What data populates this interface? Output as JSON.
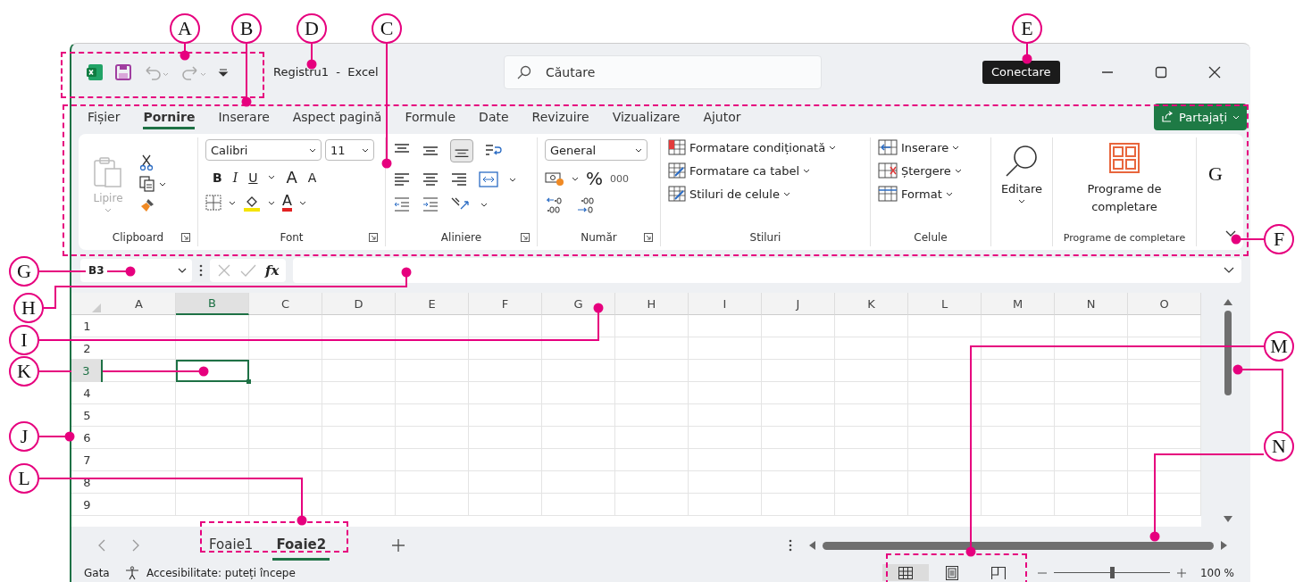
{
  "window": {
    "title": "Registru1  -  Excel"
  },
  "title_bar": {
    "search_placeholder": "Căutare",
    "sign_in": "Conectare"
  },
  "ribbon_tabs": [
    {
      "label": "Fișier",
      "selected": false
    },
    {
      "label": "Pornire",
      "selected": true
    },
    {
      "label": "Inserare",
      "selected": false
    },
    {
      "label": "Aspect pagină",
      "selected": false
    },
    {
      "label": "Formule",
      "selected": false
    },
    {
      "label": "Date",
      "selected": false
    },
    {
      "label": "Revizuire",
      "selected": false
    },
    {
      "label": "Vizualizare",
      "selected": false
    },
    {
      "label": "Ajutor",
      "selected": false
    }
  ],
  "share_button": "Partajați",
  "ribbon": {
    "clipboard": {
      "paste": "Lipire",
      "paste_disabled": true,
      "label": "Clipboard"
    },
    "font": {
      "font_name": "Calibri",
      "font_size": "11",
      "bold": "B",
      "italic": "I",
      "underline": "U",
      "grow_font": "A",
      "shrink_font": "A",
      "font_color": "A",
      "label": "Font"
    },
    "alignment": {
      "label": "Aliniere"
    },
    "number": {
      "format": "General",
      "percent": "%",
      "thousands": "000",
      "label": "Număr"
    },
    "styles": {
      "items": [
        "Formatare condiționată",
        "Formatare ca tabel",
        "Stiluri de celule"
      ],
      "label": "Stiluri"
    },
    "cells": {
      "items": [
        "Inserare",
        "Ștergere",
        "Format"
      ],
      "label": "Celule"
    },
    "editing": {
      "label": "Editare"
    },
    "addins": {
      "button": "Programe de completare",
      "label": "Programe de completare"
    }
  },
  "formula_bar": {
    "name_box": "B3",
    "fx": "fx"
  },
  "grid": {
    "columns": [
      {
        "label": "A",
        "selected": false
      },
      {
        "label": "B",
        "selected": true
      },
      {
        "label": "C",
        "selected": false
      },
      {
        "label": "D",
        "selected": false
      },
      {
        "label": "E",
        "selected": false
      },
      {
        "label": "F",
        "selected": false
      },
      {
        "label": "G",
        "selected": false
      },
      {
        "label": "H",
        "selected": false
      },
      {
        "label": "I",
        "selected": false
      },
      {
        "label": "J",
        "selected": false
      },
      {
        "label": "K",
        "selected": false
      },
      {
        "label": "L",
        "selected": false
      },
      {
        "label": "M",
        "selected": false
      },
      {
        "label": "N",
        "selected": false
      },
      {
        "label": "O",
        "selected": false
      }
    ],
    "rows": [
      {
        "label": "1",
        "selected": false
      },
      {
        "label": "2",
        "selected": false
      },
      {
        "label": "3",
        "selected": true
      },
      {
        "label": "4",
        "selected": false
      },
      {
        "label": "5",
        "selected": false
      },
      {
        "label": "6",
        "selected": false
      },
      {
        "label": "7",
        "selected": false
      },
      {
        "label": "8",
        "selected": false
      },
      {
        "label": "9",
        "selected": false
      }
    ]
  },
  "sheets": [
    {
      "label": "Foaie1",
      "selected": false
    },
    {
      "label": "Foaie2",
      "selected": true
    }
  ],
  "status_bar": {
    "status": "Gata",
    "accessibility": "Accesibilitate: puteți începe",
    "views": [
      {
        "kind": "normal",
        "selected": true
      },
      {
        "kind": "page_layout",
        "selected": false
      },
      {
        "kind": "page_break",
        "selected": false
      }
    ],
    "zoom": {
      "level": 0.5,
      "reading": "100 %"
    }
  },
  "annotations": [
    {
      "letter": "A",
      "kind": "circle"
    },
    {
      "letter": "B",
      "kind": "circle"
    },
    {
      "letter": "D",
      "kind": "circle"
    },
    {
      "letter": "C",
      "kind": "circle"
    },
    {
      "letter": "E",
      "kind": "circle"
    },
    {
      "letter": "G",
      "kind": "plain"
    },
    {
      "letter": "F",
      "kind": "circle"
    },
    {
      "letter": "G",
      "kind": "circle"
    },
    {
      "letter": "H",
      "kind": "circle"
    },
    {
      "letter": "I",
      "kind": "circle"
    },
    {
      "letter": "M",
      "kind": "circle"
    },
    {
      "letter": "K",
      "kind": "circle"
    },
    {
      "letter": "J",
      "kind": "circle"
    },
    {
      "letter": "N",
      "kind": "circle"
    },
    {
      "letter": "L",
      "kind": "circle"
    }
  ]
}
